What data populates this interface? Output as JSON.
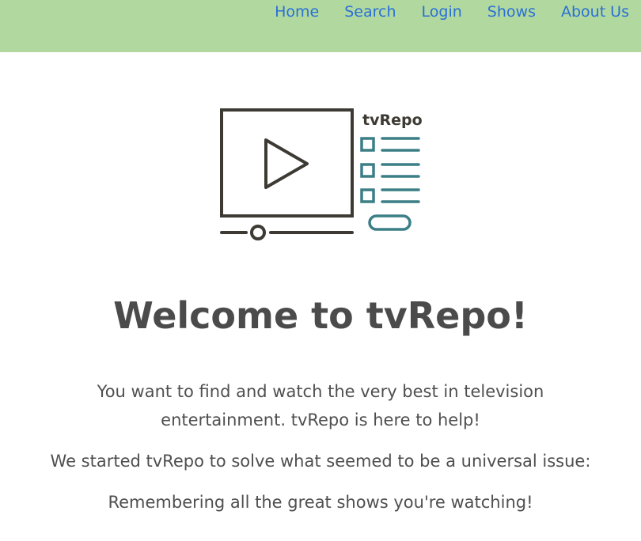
{
  "nav": {
    "items": [
      {
        "label": "Home"
      },
      {
        "label": "Search"
      },
      {
        "label": "Login"
      },
      {
        "label": "Shows"
      },
      {
        "label": "About Us"
      }
    ]
  },
  "logo": {
    "text": "tvRepo",
    "colors": {
      "dark": "#3d3a33",
      "accent": "#3b7f86"
    }
  },
  "main": {
    "title": "Welcome to tvRepo!",
    "intro_line1": "You want to find and watch the very best in television",
    "intro_line2": "entertainment. tvRepo is here to help!",
    "paragraph2": "We started tvRepo to solve what seemed to be a universal issue:",
    "paragraph3": "Remembering all the great shows you're watching!"
  },
  "colors": {
    "navbar_bg": "#b1d99f",
    "link": "#2a6fd6",
    "text": "#4f4f4f"
  }
}
